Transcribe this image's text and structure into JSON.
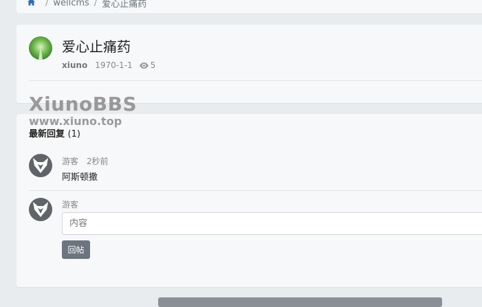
{
  "breadcrumb": {
    "items": [
      "wellcms",
      "爱心止痛药"
    ]
  },
  "thread": {
    "title": "爱心止痛药",
    "author": "xiuno",
    "date": "1970-1-1",
    "views": "5"
  },
  "watermark": {
    "line1": "XiunoBBS",
    "line2": "www.xiuno.top"
  },
  "replies": {
    "heading": "最新回复",
    "count": "(1)",
    "items": [
      {
        "user": "游客",
        "time": "2秒前",
        "content": "阿斯顿撒"
      }
    ]
  },
  "reply_form": {
    "user": "游客",
    "placeholder": "内容",
    "submit_label": "回帖"
  },
  "icons": {
    "home": "home-icon",
    "views": "eye-icon",
    "guest_avatar": "fox-avatar-icon"
  },
  "colors": {
    "accent": "#2f6fb4",
    "button": "#6c757d"
  }
}
